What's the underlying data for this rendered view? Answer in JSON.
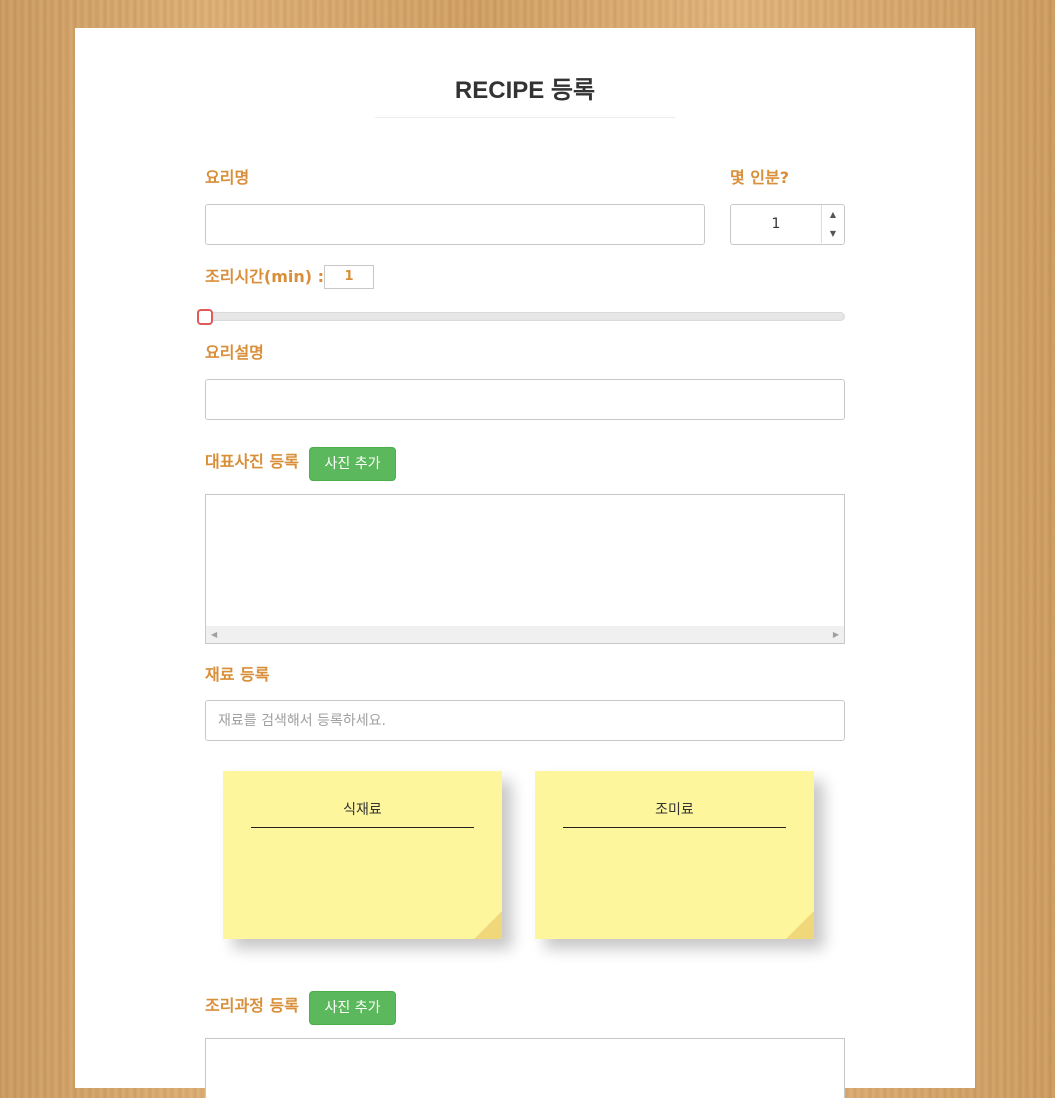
{
  "page": {
    "title": "RECIPE 등록"
  },
  "form": {
    "dish_name_label": "요리명",
    "dish_name_value": "",
    "servings_label": "몇 인분?",
    "servings_value": "1",
    "cook_time_label": "조리시간(min) :",
    "cook_time_value": "1",
    "cook_time_slider": {
      "min": 1,
      "value": 1
    },
    "description_label": "요리설명",
    "description_value": "",
    "main_photo_label": "대표사진 등록",
    "main_photo_button": "사진 추가",
    "ingredients_label": "재료 등록",
    "ingredients_placeholder": "재료를 검색해서 등록하세요.",
    "notes": [
      {
        "title": "식재료"
      },
      {
        "title": "조미료"
      }
    ],
    "steps_label": "조리과정 등록",
    "steps_button": "사진 추가"
  },
  "colors": {
    "accent": "#d98f3a",
    "button": "#5cb85c",
    "note": "#fef69c",
    "slider_handle": "#e05a5a"
  }
}
